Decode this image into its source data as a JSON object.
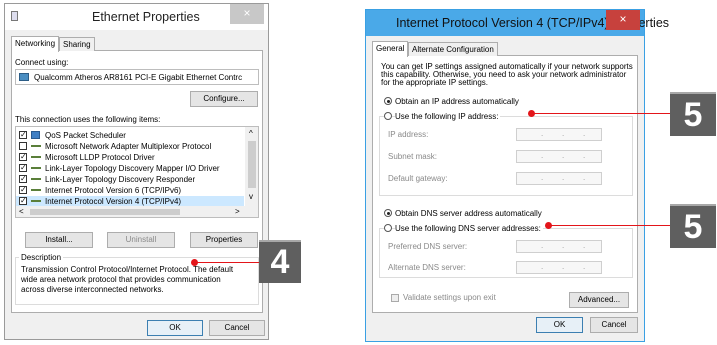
{
  "colors": {
    "accent": "#e3151a",
    "close_button": "#c7413d",
    "badge": "#5f5f5f"
  },
  "left_window": {
    "title": "Ethernet Properties",
    "close_glyph": "×",
    "tabs": [
      "Networking",
      "Sharing"
    ],
    "connect_using_label": "Connect using:",
    "adapter_name": "Qualcomm Atheros AR8161 PCI-E Gigabit Ethernet Contrc",
    "configure_button": "Configure...",
    "items_label": "This connection uses the following items:",
    "items": [
      {
        "label": "QoS Packet Scheduler",
        "checked": true,
        "icon": "qos-icon"
      },
      {
        "label": "Microsoft Network Adapter Multiplexor Protocol",
        "checked": false,
        "icon": "protocol-icon"
      },
      {
        "label": "Microsoft LLDP Protocol Driver",
        "checked": true,
        "icon": "protocol-icon"
      },
      {
        "label": "Link-Layer Topology Discovery Mapper I/O Driver",
        "checked": true,
        "icon": "protocol-icon"
      },
      {
        "label": "Link-Layer Topology Discovery Responder",
        "checked": true,
        "icon": "protocol-icon"
      },
      {
        "label": "Internet Protocol Version 6 (TCP/IPv6)",
        "checked": true,
        "icon": "protocol-icon"
      },
      {
        "label": "Internet Protocol Version 4 (TCP/IPv4)",
        "checked": true,
        "icon": "protocol-icon",
        "selected": true
      }
    ],
    "install_button": "Install...",
    "uninstall_button": "Uninstall",
    "properties_button": "Properties",
    "description_label": "Description",
    "description_text": [
      "Transmission Control Protocol/Internet Protocol. The default",
      "wide area network protocol that provides communication",
      "across diverse interconnected networks."
    ],
    "ok_button": "OK",
    "cancel_button": "Cancel",
    "scroll_up": "^",
    "scroll_down": "v",
    "scroll_left": "<",
    "scroll_right": ">"
  },
  "right_window": {
    "title": "Internet Protocol Version 4 (TCP/IPv4) Properties",
    "close_glyph": "×",
    "tabs": [
      "General",
      "Alternate Configuration"
    ],
    "intro_text": [
      "You can get IP settings assigned automatically if your network supports",
      "this capability. Otherwise, you need to ask your network administrator",
      "for the appropriate IP settings."
    ],
    "obtain_ip_auto": "Obtain an IP address automatically",
    "use_following_ip": "Use the following IP address:",
    "ip_address_label": "IP address:",
    "subnet_mask_label": "Subnet mask:",
    "default_gateway_label": "Default gateway:",
    "obtain_dns_auto": "Obtain DNS server address automatically",
    "use_following_dns": "Use the following DNS server addresses:",
    "preferred_dns_label": "Preferred DNS server:",
    "alternate_dns_label": "Alternate DNS server:",
    "validate_label": "Validate settings upon exit",
    "advanced_button": "Advanced...",
    "ok_button": "OK",
    "cancel_button": "Cancel",
    "ip_separator": "."
  },
  "callouts": [
    {
      "number": "4"
    },
    {
      "number": "5"
    },
    {
      "number": "5"
    }
  ]
}
